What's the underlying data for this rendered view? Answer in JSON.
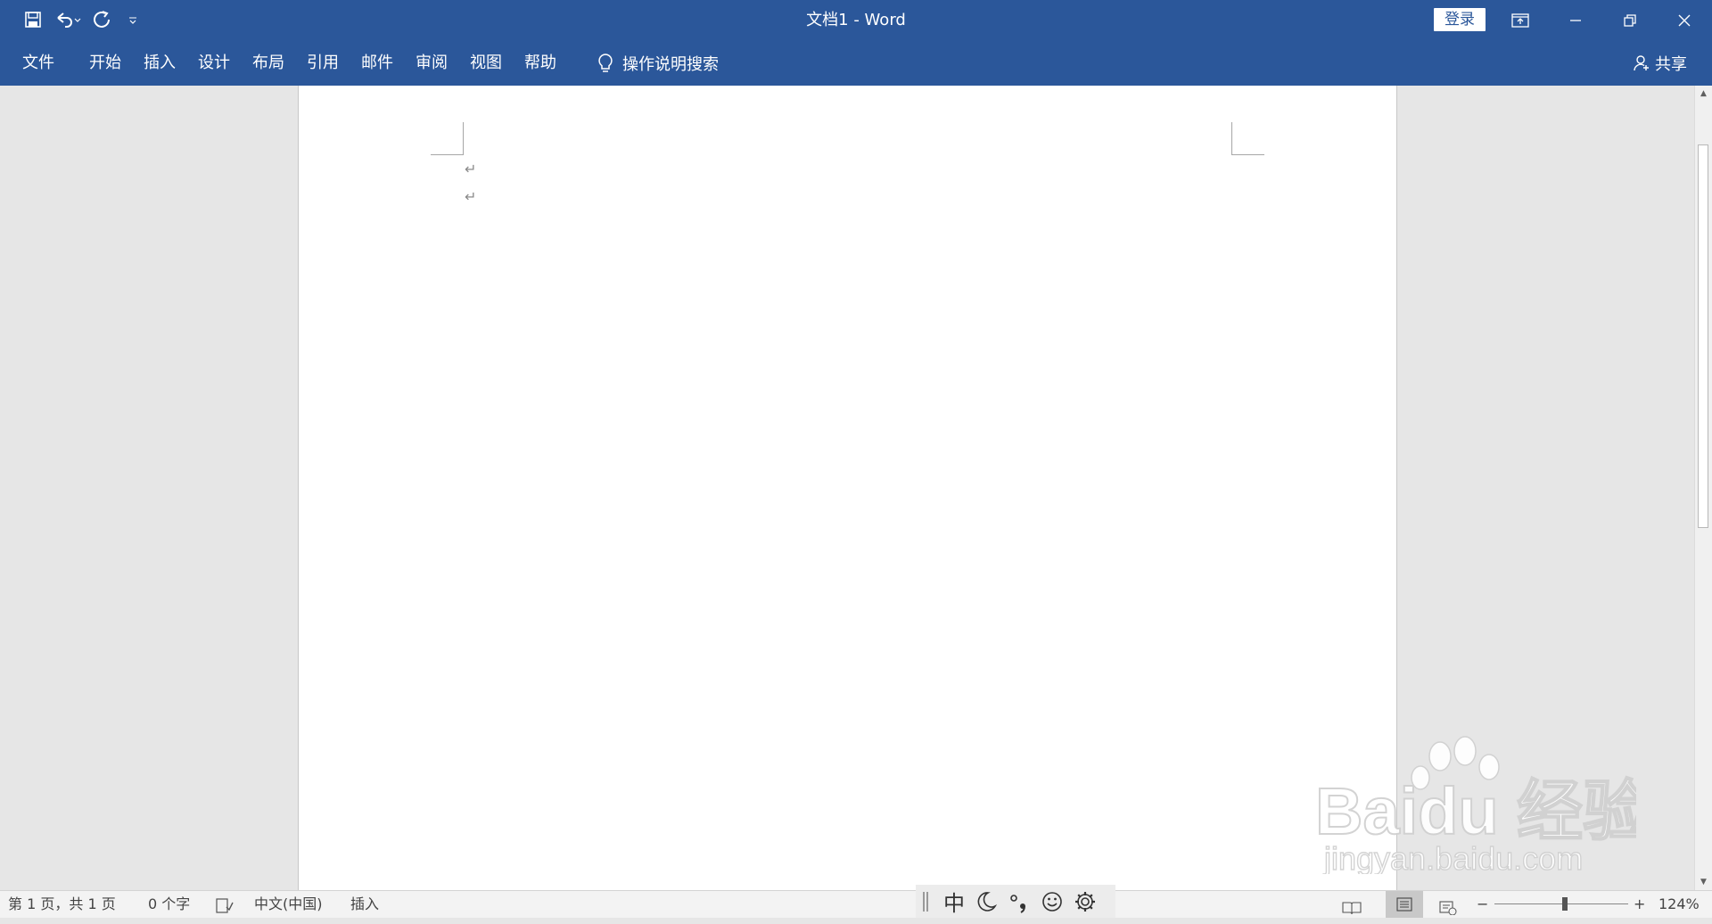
{
  "app": {
    "title": "文档1  -  Word"
  },
  "quick_access": {
    "save_icon": "save-icon",
    "undo_icon": "undo-icon",
    "redo_icon": "redo-icon",
    "customize_icon": "customize-qat-icon"
  },
  "title_buttons": {
    "login_label": "登录"
  },
  "ribbon": {
    "tabs": [
      "文件",
      "开始",
      "插入",
      "设计",
      "布局",
      "引用",
      "邮件",
      "审阅",
      "视图",
      "帮助"
    ],
    "tell_me": "操作说明搜索",
    "share": "共享"
  },
  "document": {
    "paragraph_mark": "↵"
  },
  "status": {
    "page": "第 1 页，共 1 页",
    "words": "0 个字",
    "language": "中文(中国)",
    "mode": "插入",
    "zoom": "124%",
    "zoom_minus": "−",
    "zoom_plus": "+"
  },
  "ime": {
    "mode": "中"
  },
  "watermark": {
    "brand": "Baidu 经验",
    "url": "jingyan.baidu.com"
  },
  "colors": {
    "ribbon": "#2b579a",
    "canvas": "#e6e6e6",
    "status_bg": "#f3f3f3"
  }
}
